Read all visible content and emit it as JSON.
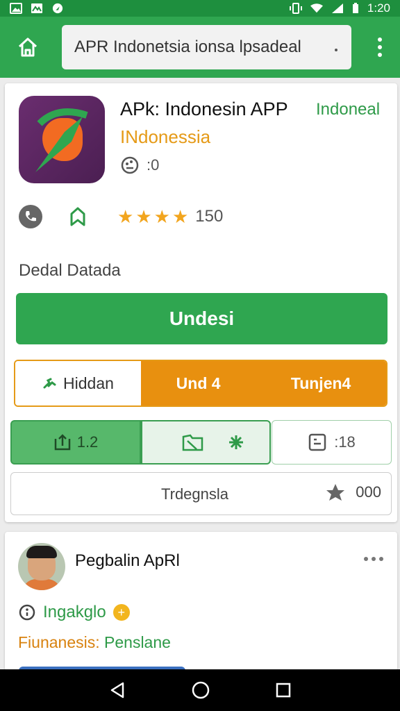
{
  "status_bar": {
    "time": "1:20",
    "left_icons": [
      "image-icon",
      "mail-icon",
      "location-icon"
    ],
    "right_icons": [
      "vibrate-icon",
      "wifi-icon",
      "signal-icon",
      "battery-icon"
    ]
  },
  "app_bar": {
    "search_text": "APR Indonetsia ionsa lpsadeal",
    "home_icon": "home-icon",
    "menu_icon": "more-vert-icon"
  },
  "app": {
    "title": "APk: Indonesin APP",
    "tag": "Indoneal",
    "developer": "INdonessia",
    "meta_count": ":0",
    "rating_count": "150",
    "stars": 4
  },
  "detail_text": "Dedal Datada",
  "install_label": "Undesi",
  "segment": {
    "left_label": "Hiddan",
    "mid_label": "Und 4",
    "right_label": "Tunjen4"
  },
  "triple": {
    "first_value": "1.2",
    "third_value": ":18"
  },
  "bottom_row": {
    "label": "Trdegnsla",
    "value": "000"
  },
  "post": {
    "name": "Pegbalin ApRl",
    "line1": "Ingakglo",
    "line2_orange": "Fiunanesis:",
    "line2_green": " Penslane"
  },
  "colors": {
    "primary_green": "#2fa650",
    "status_green": "#1e8f3e",
    "accent_orange": "#e8900f",
    "star": "#f2a51e"
  }
}
